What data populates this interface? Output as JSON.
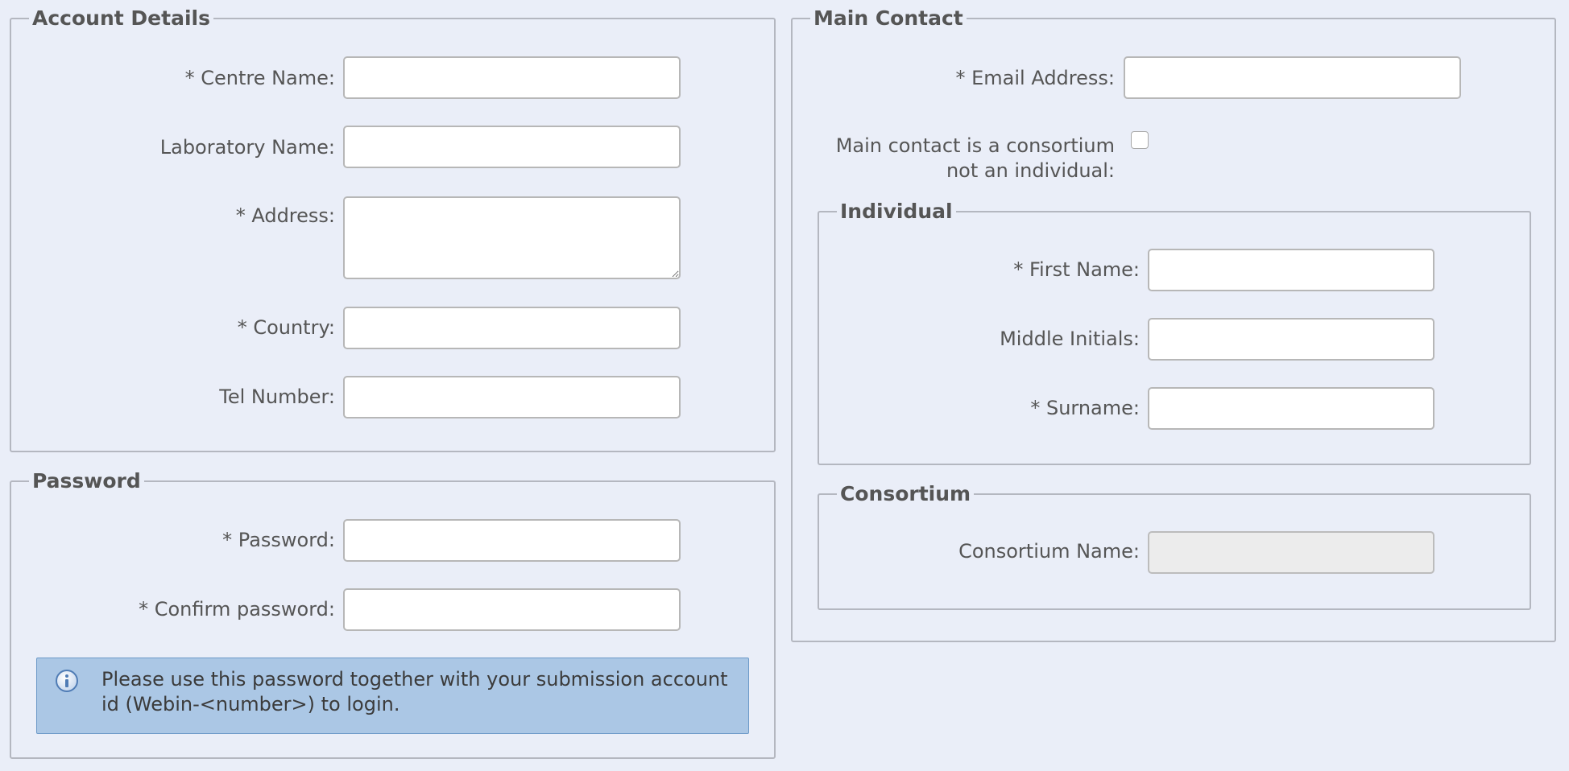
{
  "account_details": {
    "legend": "Account Details",
    "centre_name_label": "* Centre Name:",
    "laboratory_name_label": "Laboratory Name:",
    "address_label": "* Address:",
    "country_label": "* Country:",
    "tel_number_label": "Tel Number:"
  },
  "password": {
    "legend": "Password",
    "password_label": "* Password:",
    "confirm_label": "* Confirm password:",
    "info_text": "Please use this password together with your submission account id (Webin-<number>) to login.",
    "info_icon": "info-icon"
  },
  "main_contact": {
    "legend": "Main Contact",
    "email_label": "* Email Address:",
    "consortium_checkbox_label": "Main contact is a consortium not an individual:",
    "consortium_checked": false,
    "individual": {
      "legend": "Individual",
      "first_name_label": "* First Name:",
      "middle_initials_label": "Middle Initials:",
      "surname_label": "* Surname:"
    },
    "consortium": {
      "legend": "Consortium",
      "consortium_name_label": "Consortium Name:",
      "consortium_name_disabled": true
    }
  },
  "colors": {
    "background": "#eaeef8",
    "info_background": "#abc7e5",
    "info_border": "#6d9ac8",
    "disabled_input": "#ececec"
  }
}
